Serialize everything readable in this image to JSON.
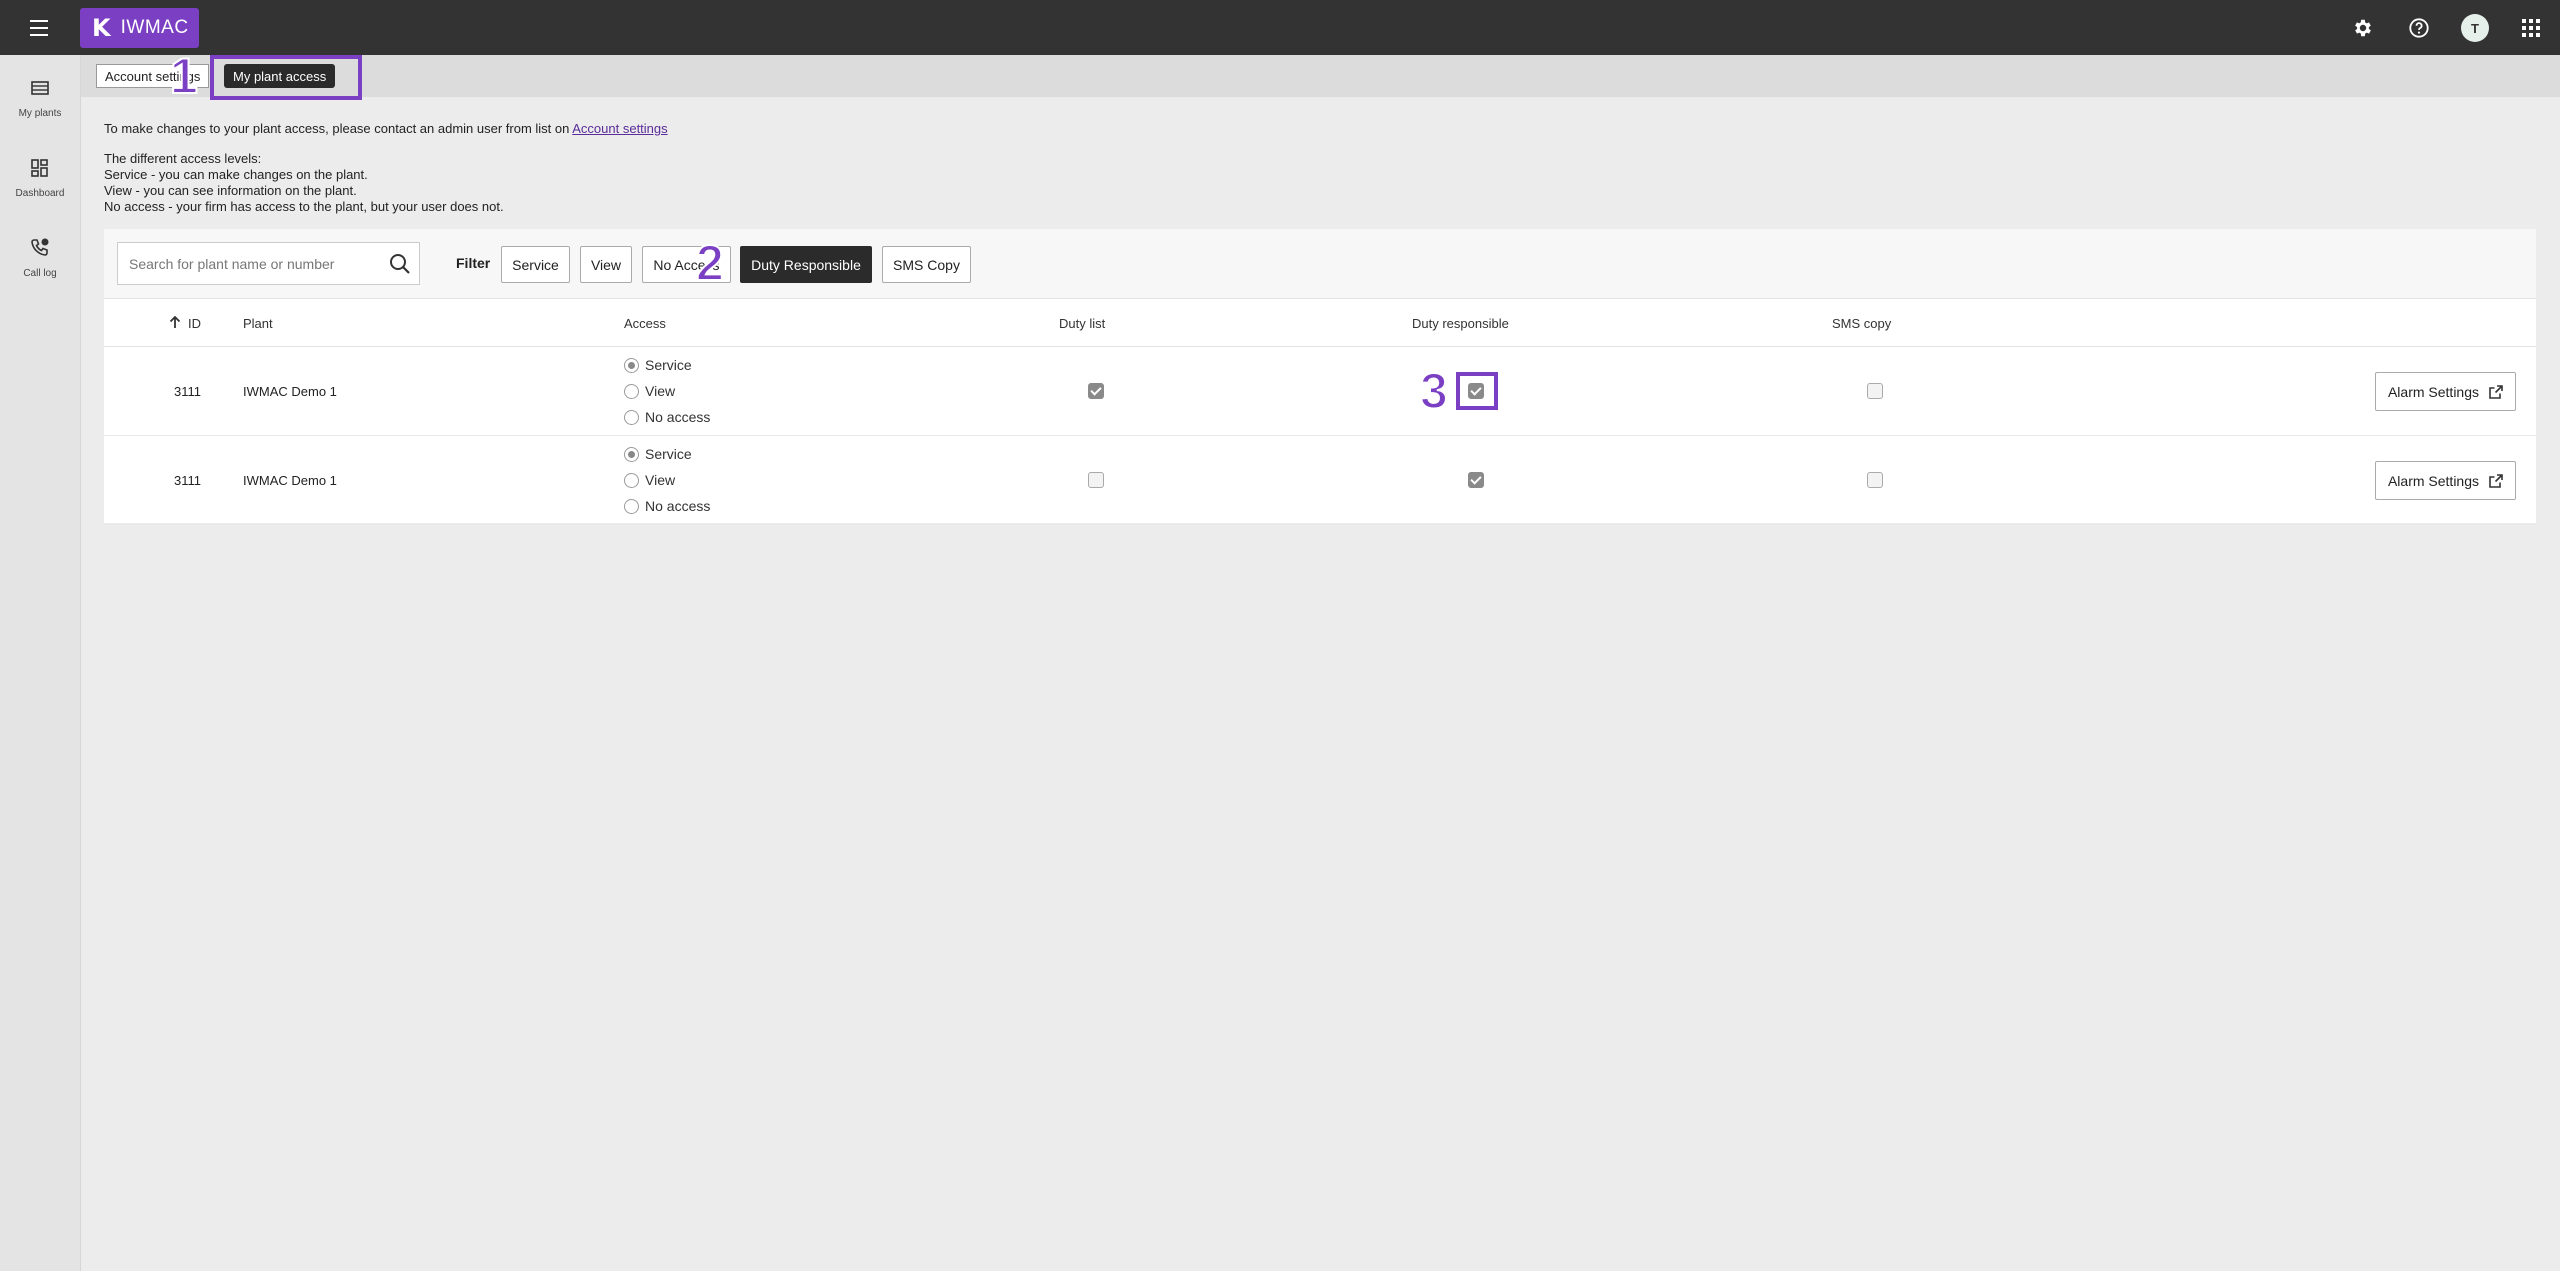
{
  "app": {
    "logo_mark": "K",
    "logo_text": "IWMAC",
    "avatar_initial": "T"
  },
  "sidebar": {
    "items": [
      {
        "label": "My plants",
        "icon": "list-icon"
      },
      {
        "label": "Dashboard",
        "icon": "dashboard-icon"
      },
      {
        "label": "Call log",
        "icon": "phone-icon"
      }
    ]
  },
  "tabs": [
    {
      "label": "Account settings",
      "active": false
    },
    {
      "label": "My plant access",
      "active": true
    }
  ],
  "markers": [
    "1",
    "2",
    "3"
  ],
  "info": {
    "line1_prefix": "To make changes to your plant access, please contact an admin user from list on ",
    "line1_link": "Account settings",
    "levels_title": "The different access levels:",
    "level_service": "Service - you can make changes on the plant.",
    "level_view": "View - you can see information on the plant.",
    "level_noaccess": "No access - your firm has access to the plant, but your user does not."
  },
  "search": {
    "placeholder": "Search for plant name or number",
    "value": ""
  },
  "filter": {
    "label": "Filter",
    "buttons": [
      {
        "label": "Service",
        "active": false
      },
      {
        "label": "View",
        "active": false
      },
      {
        "label": "No Access",
        "active": false
      },
      {
        "label": "Duty Responsible",
        "active": true
      },
      {
        "label": "SMS Copy",
        "active": false
      }
    ]
  },
  "table": {
    "headers": {
      "id": "ID",
      "plant": "Plant",
      "access": "Access",
      "duty_list": "Duty list",
      "duty_responsible": "Duty responsible",
      "sms_copy": "SMS copy"
    },
    "access_options": [
      "Service",
      "View",
      "No access"
    ],
    "action_label": "Alarm Settings",
    "rows": [
      {
        "id": "3111",
        "plant": "IWMAC Demo 1",
        "access": "Service",
        "duty_list": true,
        "duty_responsible": true,
        "sms_copy": false
      },
      {
        "id": "3111",
        "plant": "IWMAC Demo 1",
        "access": "Service",
        "duty_list": false,
        "duty_responsible": true,
        "sms_copy": false
      }
    ]
  },
  "colors": {
    "topbar": "#333333",
    "brand": "#7b3fc4",
    "active_button": "#2b2b2b",
    "background": "#ececec"
  }
}
